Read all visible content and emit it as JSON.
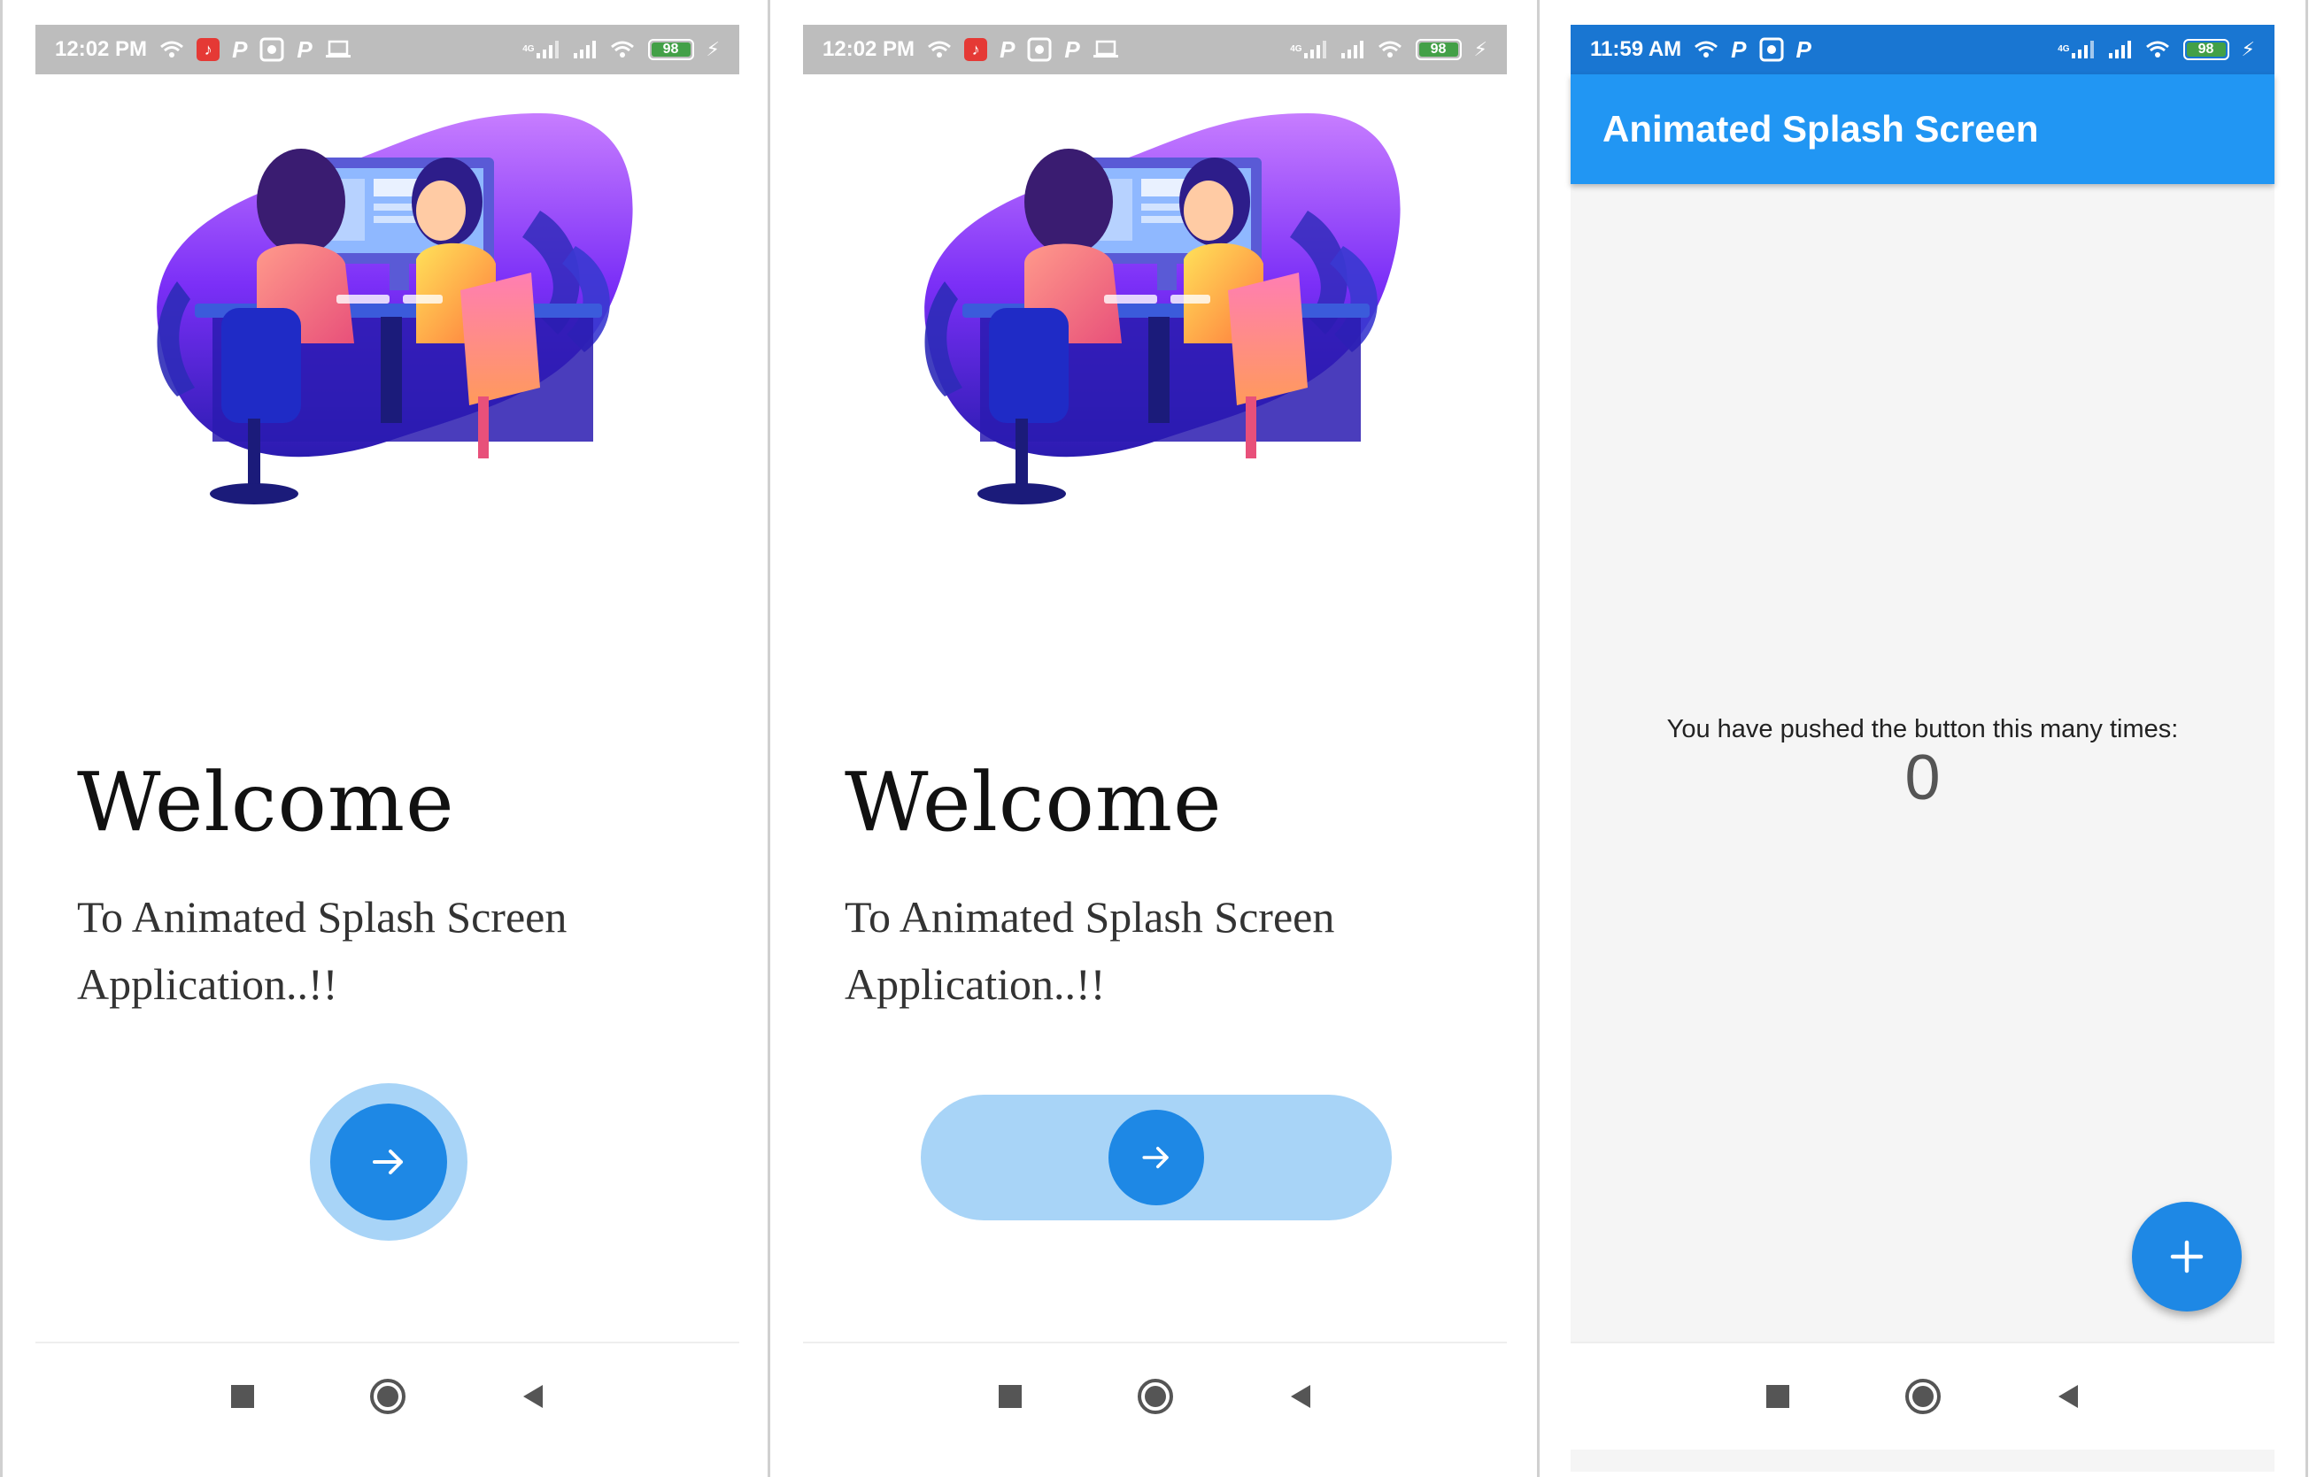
{
  "screens": [
    {
      "status": {
        "time": "12:02 PM",
        "battery": "98",
        "network": "4G"
      },
      "welcome": {
        "title": "Welcome",
        "line1": "To Animated Splash Screen",
        "line2": "Application..!!"
      },
      "go_button_state": "circle"
    },
    {
      "status": {
        "time": "12:02 PM",
        "battery": "98",
        "network": "4G"
      },
      "welcome": {
        "title": "Welcome",
        "line1": "To Animated Splash Screen",
        "line2": "Application..!!"
      },
      "go_button_state": "expanded-pill"
    },
    {
      "status": {
        "time": "11:59 AM",
        "battery": "98",
        "network": "4G"
      },
      "appbar": {
        "title": "Animated Splash Screen"
      },
      "counter": {
        "label": "You have pushed the button this many times:",
        "value": "0"
      },
      "fab": {
        "icon": "plus-icon"
      }
    }
  ],
  "icons": {
    "status": [
      "wifi-icon",
      "tiktok-icon",
      "p-app-icon",
      "camera-icon",
      "laptop-icon",
      "signal-icon",
      "battery-icon",
      "charging-icon"
    ],
    "nav": [
      "recent-apps-icon",
      "home-icon",
      "back-icon"
    ],
    "go": "arrow-right-icon"
  },
  "colors": {
    "primary": "#2196f3",
    "primary_dark": "#1976d2",
    "fab": "#1e88e5",
    "go_halo": "#a8d4f7",
    "statusbar_gray": "#bdbdbd",
    "battery_green": "#43a047"
  }
}
